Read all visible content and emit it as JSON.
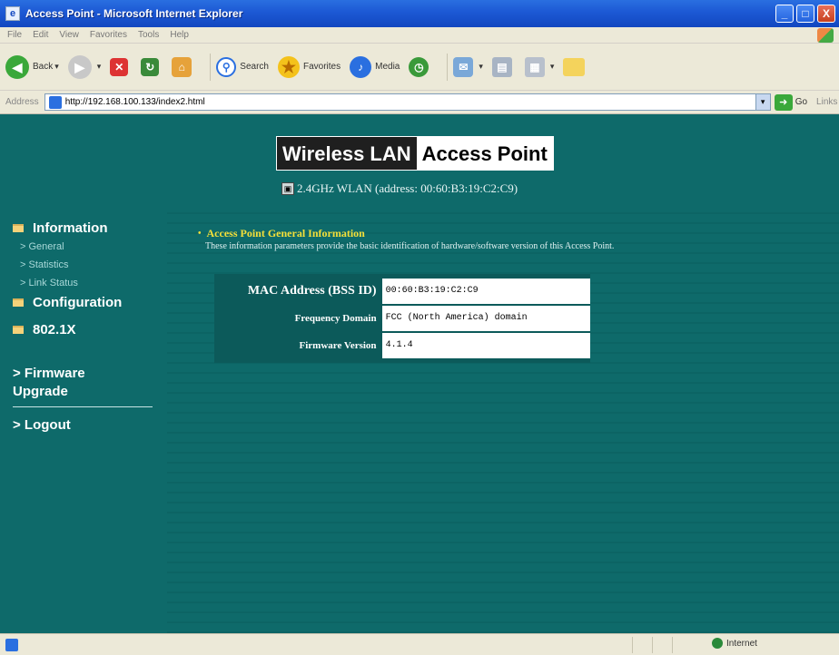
{
  "window": {
    "title": "Access Point - Microsoft Internet Explorer",
    "minimize": "_",
    "maximize": "□",
    "close": "X"
  },
  "menu": [
    "File",
    "Edit",
    "View",
    "Favorites",
    "Tools",
    "Help"
  ],
  "toolbar": {
    "back_label": "Back",
    "search_label": "Search",
    "favorites_label": "Favorites",
    "media_label": "Media"
  },
  "addressbar": {
    "label": "Address",
    "url": "http://192.168.100.133/index2.html",
    "go_label": "Go",
    "links_label": "Links"
  },
  "header": {
    "logo_part1": "Wireless LAN",
    "logo_part2": "Access Point",
    "subtitle": "2.4GHz WLAN (address: 00:60:B3:19:C2:C9)"
  },
  "sidebar": {
    "information": "Information",
    "information_items": [
      "> General",
      "> Statistics",
      "> Link Status"
    ],
    "configuration": "Configuration",
    "dot1x": "802.1X",
    "firmware": "> Firmware Upgrade",
    "logout": "> Logout"
  },
  "main": {
    "section_title": "Access Point General Information",
    "section_desc": "These information parameters provide the basic identification of hardware/software version of this Access Point.",
    "rows": [
      {
        "key": "MAC Address (BSS ID)",
        "value": "00:60:B3:19:C2:C9"
      },
      {
        "key": "Frequency Domain",
        "value": "FCC (North America) domain"
      },
      {
        "key": "Firmware Version",
        "value": "4.1.4"
      }
    ]
  },
  "statusbar": {
    "zone": "Internet"
  },
  "colors": {
    "content_bg": "#0e6a6a",
    "section_title": "#f4e03a"
  }
}
